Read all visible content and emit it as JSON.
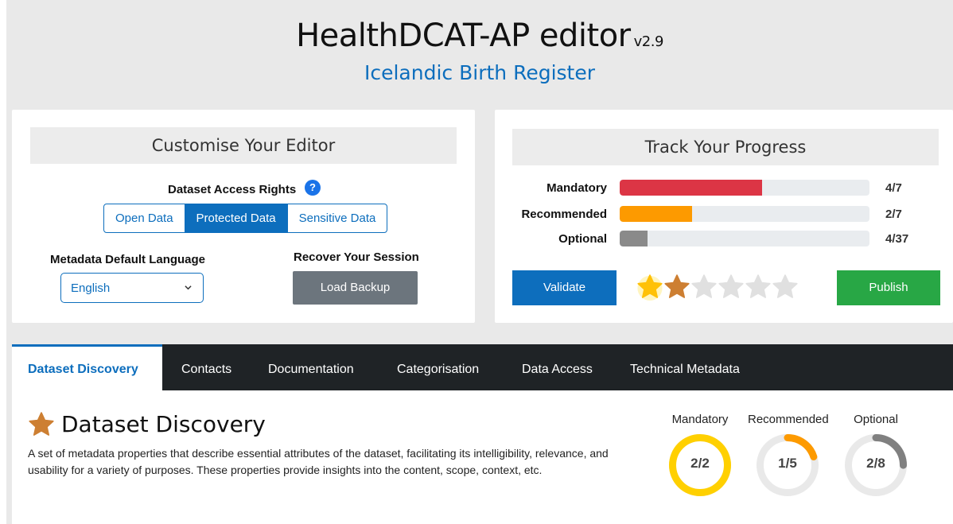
{
  "header": {
    "title": "HealthDCAT-AP editor",
    "version": "v2.9",
    "subtitle": "Icelandic Birth Register"
  },
  "customise": {
    "title": "Customise Your Editor",
    "access_label": "Dataset Access Rights",
    "help_icon": "?",
    "access_options": [
      "Open Data",
      "Protected Data",
      "Sensitive Data"
    ],
    "access_selected": "Protected Data",
    "language_label": "Metadata Default Language",
    "language_value": "English",
    "recover_label": "Recover Your Session",
    "load_button": "Load Backup"
  },
  "progress": {
    "title": "Track Your Progress",
    "rows": [
      {
        "label": "Mandatory",
        "count": "4/7",
        "fraction": 0.57,
        "color": "#dc3545"
      },
      {
        "label": "Recommended",
        "count": "2/7",
        "fraction": 0.29,
        "color": "#fd9a00"
      },
      {
        "label": "Optional",
        "count": "4/37",
        "fraction": 0.11,
        "color": "#8a8a8a"
      }
    ],
    "validate_button": "Validate",
    "publish_button": "Publish",
    "stars": {
      "filled_gold": 1,
      "filled_bronze": 1,
      "total": 6,
      "gold_color": "#ffc107",
      "bronze_color": "#cd7f32",
      "empty_color": "#e0e0e0"
    }
  },
  "tabs": [
    "Dataset Discovery",
    "Contacts",
    "Documentation",
    "Categorisation",
    "Data Access",
    "Technical Metadata"
  ],
  "active_tab": "Dataset Discovery",
  "section": {
    "icon": "star-icon",
    "title": "Dataset Discovery",
    "description": "A set of metadata properties that describe essential attributes of the dataset, facilitating its intelligibility, relevance, and usability for a variety of purposes. These properties provide insights into the content, scope, context, etc.",
    "rings": [
      {
        "label": "Mandatory",
        "value": "2/2",
        "fraction": 1.0,
        "color": "#ffd000"
      },
      {
        "label": "Recommended",
        "value": "1/5",
        "fraction": 0.2,
        "color": "#fd9a00"
      },
      {
        "label": "Optional",
        "value": "2/8",
        "fraction": 0.25,
        "color": "#808080"
      }
    ]
  }
}
